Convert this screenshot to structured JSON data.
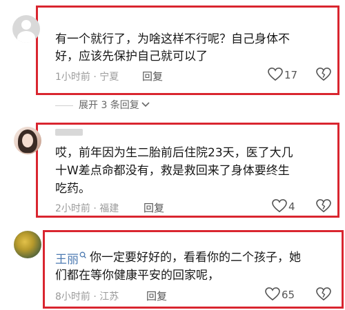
{
  "comments": [
    {
      "name": "",
      "text_lines": [
        "有一个就行了，为啥这样不行呢？自己身体不",
        "好，应该先保护自己就可以了"
      ],
      "time": "1小时前",
      "location": "宁夏",
      "reply_label": "回复",
      "likes": "17",
      "expand_label": "展开 3 条回复"
    },
    {
      "name": "",
      "text_lines": [
        "哎，前年因为生二胎前后住院23天，医了大几",
        "十W差点命都没有，救是救回来了身体要终生",
        "吃药。"
      ],
      "time": "2小时前",
      "location": "福建",
      "reply_label": "回复",
      "likes": "4"
    },
    {
      "name": "王丽",
      "text_lines": [
        "你一定要好好的，看看你的二个孩子，她",
        "们都在等你健康平安的回家呢，"
      ],
      "time": "8小时前",
      "location": "江苏",
      "reply_label": "回复",
      "likes": "65"
    }
  ],
  "icons": [
    "heart-icon",
    "dislike-heart-icon",
    "chevron-down-icon",
    "search-icon"
  ],
  "colors": {
    "highlight_border": "#d9252f",
    "name": "#4b79b1",
    "meta": "#9a9a9a"
  }
}
